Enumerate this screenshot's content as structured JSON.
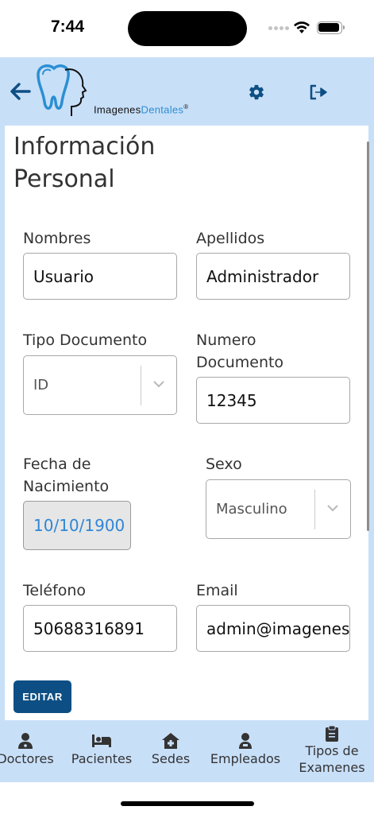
{
  "status_bar": {
    "time": "7:44"
  },
  "header": {
    "logo_part1": "Imagenes",
    "logo_part2": "Dentales",
    "logo_reg": "®",
    "icons": [
      "back-arrow-icon",
      "gear-icon",
      "logout-icon"
    ],
    "accent_color": "#2b8fd2",
    "background_color": "#c8dff8"
  },
  "page": {
    "title": "Información Personal"
  },
  "form": {
    "nombres_label": "Nombres",
    "nombres_value": "Usuario",
    "apellidos_label": "Apellidos",
    "apellidos_value": "Administrador",
    "tipo_documento_label": "Tipo Documento",
    "tipo_documento_value": "ID",
    "numero_documento_label": "Numero Documento",
    "numero_documento_value": "12345",
    "fecha_label": "Fecha de Nacimiento",
    "fecha_value": "10/10/1900",
    "sexo_label": "Sexo",
    "sexo_value": "Masculino",
    "telefono_label": "Teléfono",
    "telefono_value": "50688316891",
    "email_label": "Email",
    "email_value": "admin@imagenesdentales.com"
  },
  "actions": {
    "edit_label": "EDITAR",
    "edit_color": "#0d4f84"
  },
  "tabs": [
    {
      "label": "Doctores",
      "icon": "doctor-icon"
    },
    {
      "label": "Pacientes",
      "icon": "bed-icon"
    },
    {
      "label": "Sedes",
      "icon": "clinic-icon"
    },
    {
      "label": "Empleados",
      "icon": "employee-icon"
    },
    {
      "label": "Tipos de Examenes",
      "icon": "clipboard-icon"
    }
  ]
}
